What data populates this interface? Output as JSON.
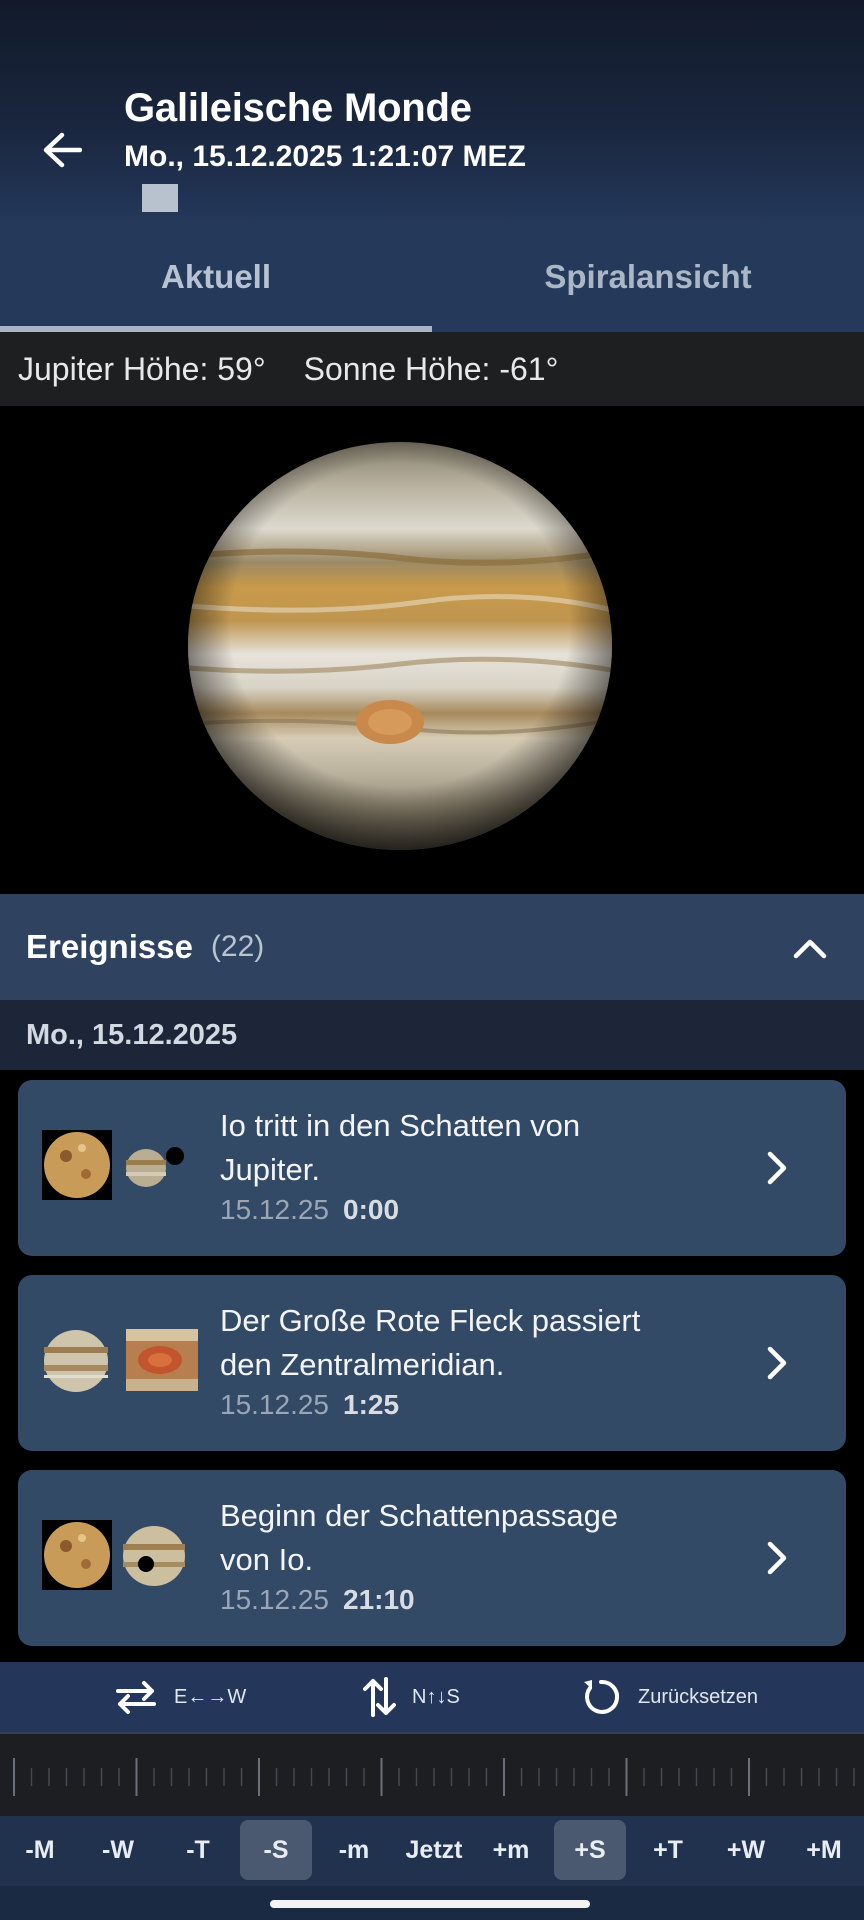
{
  "header": {
    "title": "Galileische Monde",
    "subtitle": "Mo., 15.12.2025 1:21:07 MEZ"
  },
  "tabs": [
    {
      "label": "Aktuell",
      "active": true
    },
    {
      "label": "Spiralansicht",
      "active": false
    }
  ],
  "altitude": {
    "jupiter": "Jupiter Höhe: 59°",
    "sun": "Sonne Höhe: -61°"
  },
  "events": {
    "title": "Ereignisse",
    "count": "(22)",
    "date": "Mo., 15.12.2025",
    "items": [
      {
        "desc_line1": "Io tritt in den Schatten von",
        "desc_line2": "Jupiter.",
        "date": "15.12.25",
        "time": "0:00",
        "icons": [
          "io-moon-icon",
          "jupiter-shadow-icon"
        ]
      },
      {
        "desc_line1": "Der Große Rote Fleck passiert",
        "desc_line2": "den Zentralmeridian.",
        "date": "15.12.25",
        "time": "1:25",
        "icons": [
          "jupiter-icon",
          "great-red-spot-icon"
        ]
      },
      {
        "desc_line1": "Beginn der Schattenpassage",
        "desc_line2": "von Io.",
        "date": "15.12.25",
        "time": "21:10",
        "icons": [
          "io-moon-icon",
          "shadow-transit-icon"
        ]
      }
    ]
  },
  "controls": {
    "flip_ew": "E←→W",
    "flip_ns": "N↑↓S",
    "reset": "Zurücksetzen"
  },
  "timebar": {
    "buttons": [
      {
        "label": "-M",
        "selected": false
      },
      {
        "label": "-W",
        "selected": false
      },
      {
        "label": "-T",
        "selected": false
      },
      {
        "label": "-S",
        "selected": true
      },
      {
        "label": "-m",
        "selected": false
      },
      {
        "label": "Jetzt",
        "selected": false
      },
      {
        "label": "+m",
        "selected": false
      },
      {
        "label": "+S",
        "selected": true
      },
      {
        "label": "+T",
        "selected": false
      },
      {
        "label": "+W",
        "selected": false
      },
      {
        "label": "+M",
        "selected": false
      }
    ]
  },
  "colors": {
    "header_bg": "#1a2740",
    "tab_bg": "#25395a",
    "card_bg": "#334a66",
    "events_header_bg": "#2f4360",
    "selected_button_bg": "#4a5870"
  }
}
